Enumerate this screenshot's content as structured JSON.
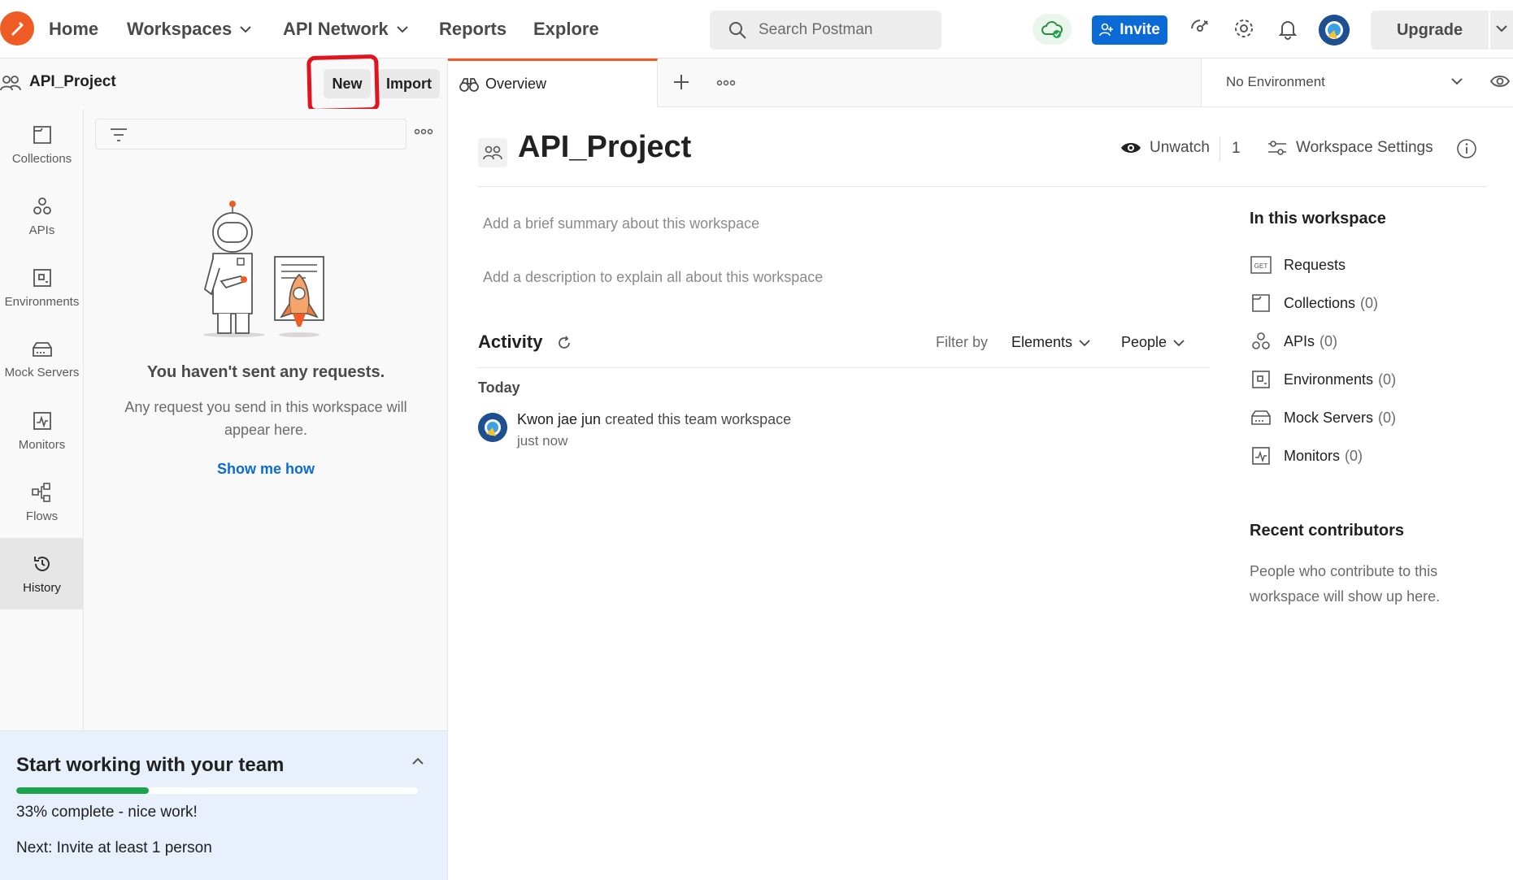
{
  "topbar": {
    "nav": [
      "Home",
      "Workspaces",
      "API Network",
      "Reports",
      "Explore"
    ],
    "search_placeholder": "Search Postman",
    "invite_label": "Invite",
    "upgrade_label": "Upgrade"
  },
  "workspace": {
    "name": "API_Project",
    "new_label": "New",
    "import_label": "Import"
  },
  "sidebar": {
    "items": [
      {
        "label": "Collections",
        "icon": "collections-icon"
      },
      {
        "label": "APIs",
        "icon": "apis-icon"
      },
      {
        "label": "Environments",
        "icon": "environments-icon"
      },
      {
        "label": "Mock Servers",
        "icon": "mock-servers-icon"
      },
      {
        "label": "Monitors",
        "icon": "monitors-icon"
      },
      {
        "label": "Flows",
        "icon": "flows-icon"
      },
      {
        "label": "History",
        "icon": "history-icon",
        "active": true
      }
    ]
  },
  "history_panel": {
    "empty_title": "You haven't sent any requests.",
    "empty_desc": "Any request you send in this workspace will appear here.",
    "show_me_how": "Show me how"
  },
  "team_panel": {
    "title": "Start working with your team",
    "progress": 0.33,
    "status": "33% complete - nice work!",
    "next": "Next: Invite at least 1 person"
  },
  "tabs": {
    "active_label": "Overview"
  },
  "environment": {
    "selected": "No Environment"
  },
  "overview": {
    "title": "API_Project",
    "unwatch_label": "Unwatch",
    "watch_count": "1",
    "settings_label": "Workspace Settings",
    "summary_placeholder": "Add a brief summary about this workspace",
    "description_placeholder": "Add a description to explain all about this workspace",
    "activity_title": "Activity",
    "filter_by": "Filter by",
    "filter_elements": "Elements",
    "filter_people": "People",
    "today_label": "Today",
    "activity": {
      "user": "Kwon jae jun",
      "action": " created this team workspace",
      "time": "just now"
    }
  },
  "in_workspace": {
    "title": "In this workspace",
    "items": [
      {
        "label": "Requests",
        "count": ""
      },
      {
        "label": "Collections",
        "count": "(0)"
      },
      {
        "label": "APIs",
        "count": "(0)"
      },
      {
        "label": "Environments",
        "count": "(0)"
      },
      {
        "label": "Mock Servers",
        "count": "(0)"
      },
      {
        "label": "Monitors",
        "count": "(0)"
      }
    ]
  },
  "contributors": {
    "title": "Recent contributors",
    "desc": "People who contribute to this workspace will show up here."
  },
  "colors": {
    "brand_orange": "#ef5b25",
    "invite_blue": "#0b6bd6",
    "progress_green": "#1aa34a",
    "highlight_red": "#e0141e"
  }
}
